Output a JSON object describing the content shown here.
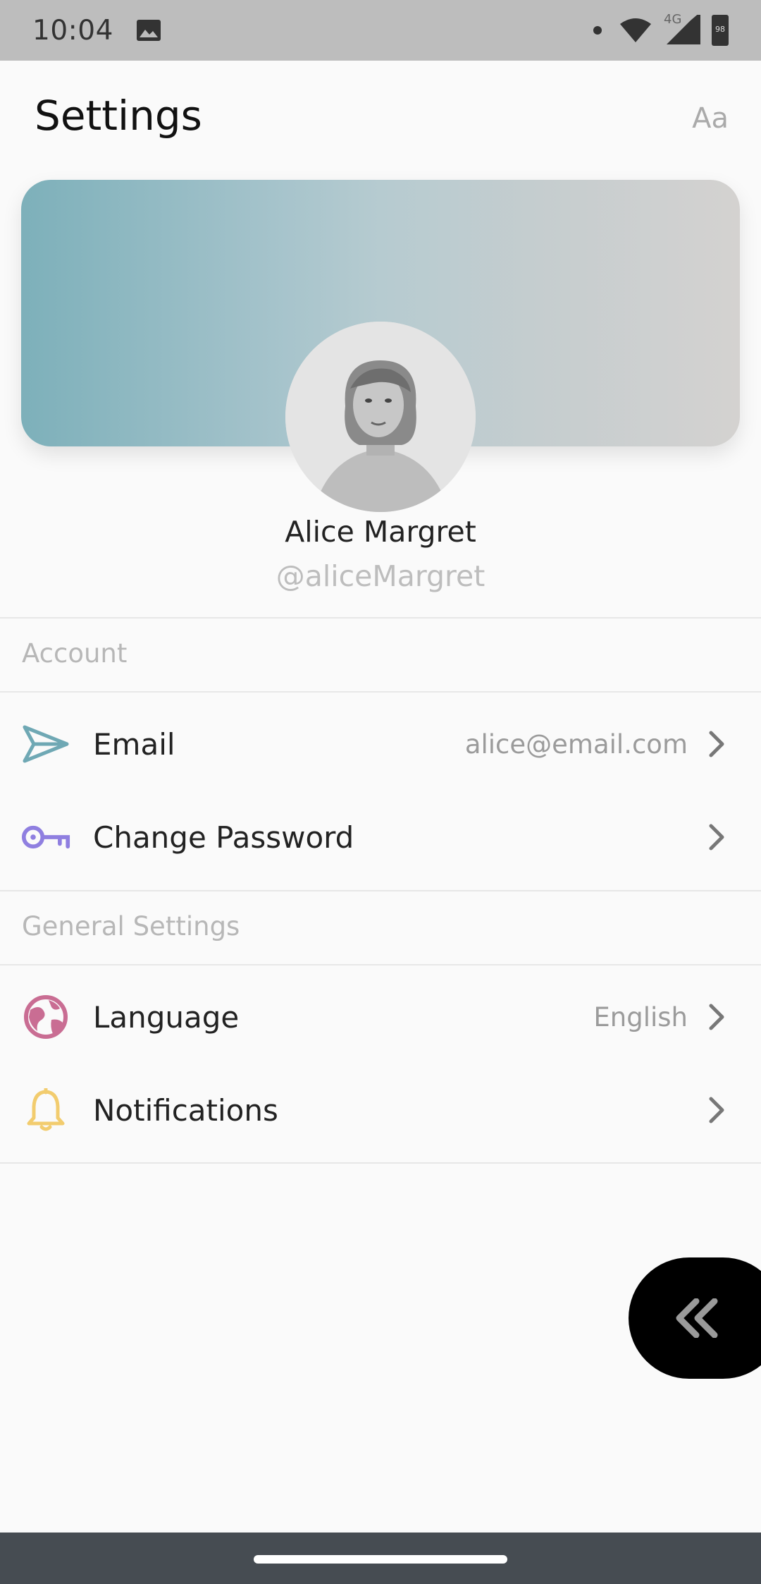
{
  "status_bar": {
    "time": "10:04",
    "network": "4G",
    "battery": "98",
    "icons": [
      "image-icon",
      "wifi-icon",
      "signal-icon",
      "battery-icon"
    ]
  },
  "header": {
    "title": "Settings",
    "font_button": "Aa"
  },
  "profile": {
    "name": "Alice Margret",
    "handle": "@aliceMargret"
  },
  "sections": {
    "account": {
      "label": "Account",
      "rows": [
        {
          "label": "Email",
          "value": "alice@email.com",
          "icon": "send-icon",
          "color": "#6fa8b4"
        },
        {
          "label": "Change Password",
          "value": "",
          "icon": "key-icon",
          "color": "#8f7fe0"
        }
      ]
    },
    "general": {
      "label": "General Settings",
      "rows": [
        {
          "label": "Language",
          "value": "English",
          "icon": "globe-icon",
          "color": "#c96d93"
        },
        {
          "label": "Notifications",
          "value": "",
          "icon": "bell-icon",
          "color": "#f2cc6e"
        }
      ]
    }
  },
  "colors": {
    "background": "#fafafa",
    "status_bar": "#bdbdbd",
    "nav_bar": "#464c52",
    "muted_text": "#b7b7b7",
    "fab": "#000000"
  }
}
